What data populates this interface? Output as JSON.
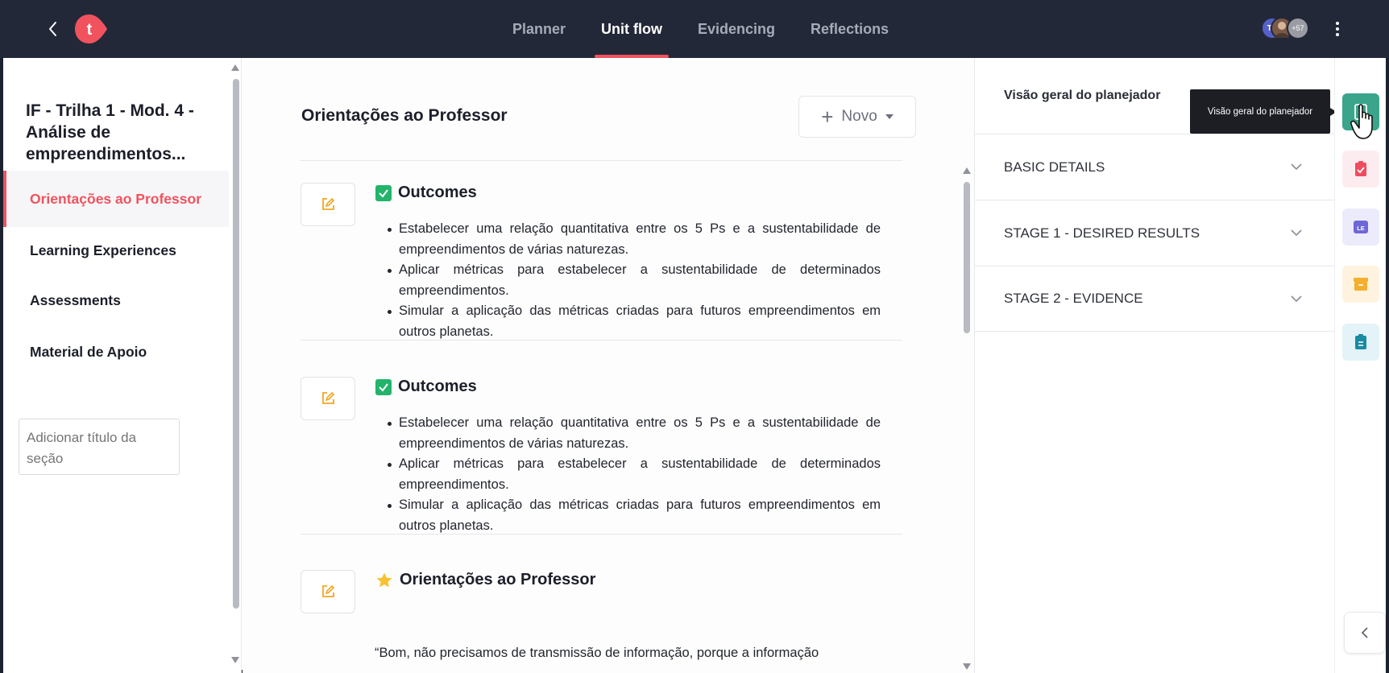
{
  "topbar": {
    "logo_letter": "t",
    "tabs": [
      {
        "label": "Planner",
        "active": false
      },
      {
        "label": "Unit flow",
        "active": true
      },
      {
        "label": "Evidencing",
        "active": false
      },
      {
        "label": "Reflections",
        "active": false
      }
    ],
    "avatars": {
      "first_initials": "TS",
      "more_count": "+57"
    },
    "accent_color": "#f0535e",
    "background_color": "#232839"
  },
  "sidebar": {
    "unit_title": "IF - Trilha 1 - Mod. 4 - Análise de empreendimentos...",
    "items": [
      {
        "label": "Orientações ao Professor",
        "active": true
      },
      {
        "label": "Learning Experiences",
        "active": false
      },
      {
        "label": "Assessments",
        "active": false
      },
      {
        "label": "Material de Apoio",
        "active": false
      }
    ],
    "section_input_placeholder": "Adicionar título da seção"
  },
  "main": {
    "heading": "Orientações ao Professor",
    "new_button_label": "Novo",
    "blocks": [
      {
        "icon": "check-icon",
        "title": "Outcomes",
        "items": [
          "Estabelecer uma relação quantitativa entre os 5 Ps e a sustentabilidade de empreendimentos de várias naturezas.",
          "Aplicar métricas para estabelecer a sustentabilidade de determinados empreendimentos.",
          "Simular a aplicação das métricas criadas para futuros empreendimentos em outros planetas."
        ]
      },
      {
        "icon": "check-icon",
        "title": "Outcomes",
        "items": [
          "Estabelecer uma relação quantitativa entre os 5 Ps e a sustentabilidade de empreendimentos de várias naturezas.",
          "Aplicar métricas para estabelecer a sustentabilidade de determinados empreendimentos.",
          "Simular a aplicação das métricas criadas para futuros empreendimentos em outros planetas."
        ]
      },
      {
        "icon": "star-icon",
        "title": "Orientações ao Professor",
        "text": "“Bom, não precisamos de transmissão de informação, porque a informação"
      }
    ]
  },
  "right_panel": {
    "title": "Visão geral do planejador",
    "sections": [
      {
        "label": "BASIC DETAILS"
      },
      {
        "label": "STAGE 1 - DESIRED RESULTS"
      },
      {
        "label": "STAGE 2 - EVIDENCE"
      }
    ],
    "tooltip": "Visão geral do planejador"
  },
  "rail": {
    "buttons": [
      {
        "icon": "planner-overview-icon",
        "bg": "#3aa58a",
        "fg": "#ffffff"
      },
      {
        "icon": "clipboard-check-icon",
        "bg": "#fdecef",
        "fg": "#ef4c5f"
      },
      {
        "icon": "learning-experience-icon",
        "bg": "#ecebfb",
        "fg": "#6e67d8",
        "text": "LE"
      },
      {
        "icon": "archive-icon",
        "bg": "#fff3e0",
        "fg": "#f6ae2d"
      },
      {
        "icon": "clipboard-icon",
        "bg": "#e4f3f7",
        "fg": "#1a8aa5"
      }
    ]
  }
}
